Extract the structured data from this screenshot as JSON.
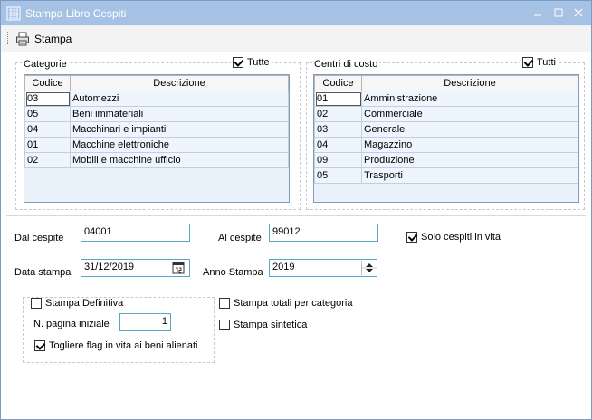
{
  "window": {
    "title": "Stampa Libro Cespiti"
  },
  "toolbar": {
    "print_label": "Stampa"
  },
  "categorie": {
    "title": "Categorie",
    "tutte_label": "Tutte",
    "tutte_checked": true,
    "headers": [
      "Codice",
      "Descrizione"
    ],
    "rows": [
      [
        "03",
        "Automezzi"
      ],
      [
        "05",
        "Beni immateriali"
      ],
      [
        "04",
        "Macchinari e impianti"
      ],
      [
        "01",
        "Macchine elettroniche"
      ],
      [
        "02",
        "Mobili e macchine ufficio"
      ]
    ]
  },
  "centri": {
    "title": "Centri di costo",
    "tutti_label": "Tutti",
    "tutti_checked": true,
    "headers": [
      "Codice",
      "Descrizione"
    ],
    "rows": [
      [
        "01",
        "Amministrazione"
      ],
      [
        "02",
        "Commerciale"
      ],
      [
        "03",
        "Generale"
      ],
      [
        "04",
        "Magazzino"
      ],
      [
        "09",
        "Produzione"
      ],
      [
        "05",
        "Trasporti"
      ]
    ]
  },
  "form": {
    "dal_cespite_label": "Dal cespite",
    "dal_cespite_value": "04001",
    "al_cespite_label": "Al cespite",
    "al_cespite_value": "99012",
    "solo_in_vita_label": "Solo cespiti in vita",
    "solo_in_vita_checked": true,
    "data_stampa_label": "Data stampa",
    "data_stampa_value": "31/12/2019",
    "anno_stampa_label": "Anno Stampa",
    "anno_stampa_value": "2019",
    "stampa_definitiva_label": "Stampa Definitiva",
    "stampa_definitiva_checked": false,
    "pagina_iniziale_label": "N. pagina iniziale",
    "pagina_iniziale_value": "1",
    "togliere_flag_label": "Togliere flag in vita ai beni alienati",
    "togliere_flag_checked": true,
    "totali_categoria_label": "Stampa totali per categoria",
    "totali_categoria_checked": false,
    "sintetica_label": "Stampa sintetica",
    "sintetica_checked": false
  }
}
